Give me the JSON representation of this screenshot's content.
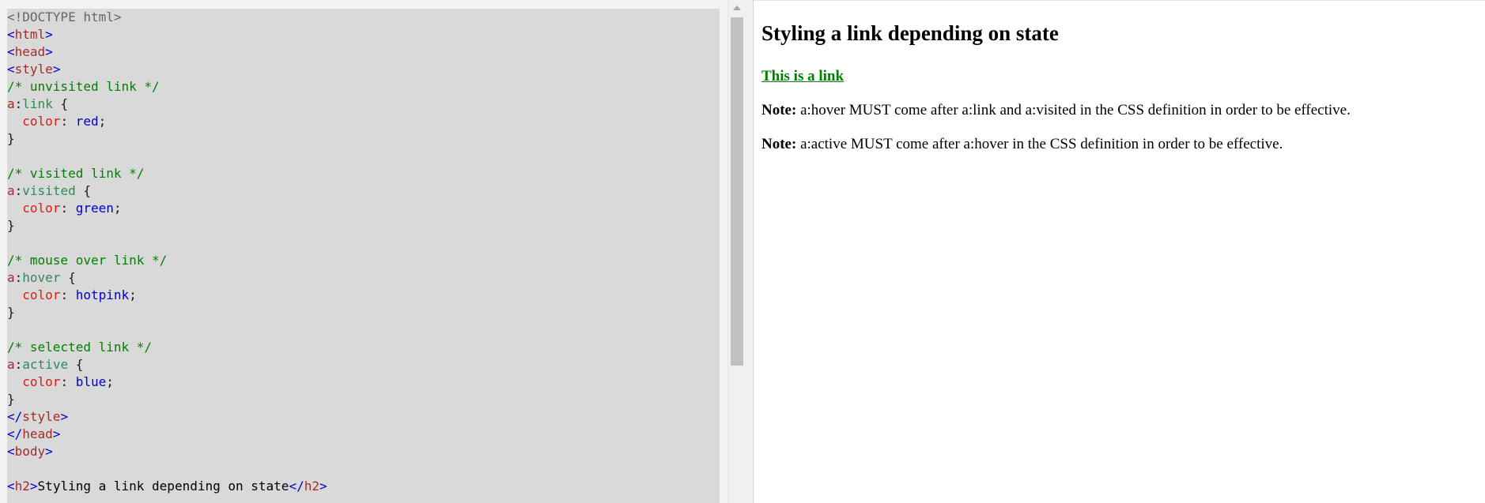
{
  "editor": {
    "lines": [
      [
        {
          "t": "<!DOCTYPE html>",
          "c": "doc"
        }
      ],
      [
        {
          "t": "<",
          "c": "br"
        },
        {
          "t": "html",
          "c": "tag"
        },
        {
          "t": ">",
          "c": "br"
        }
      ],
      [
        {
          "t": "<",
          "c": "br"
        },
        {
          "t": "head",
          "c": "tag"
        },
        {
          "t": ">",
          "c": "br"
        }
      ],
      [
        {
          "t": "<",
          "c": "br"
        },
        {
          "t": "style",
          "c": "tag"
        },
        {
          "t": ">",
          "c": "br"
        }
      ],
      [
        {
          "t": "/* unvisited link */",
          "c": "com"
        }
      ],
      [
        {
          "t": "a",
          "c": "sel"
        },
        {
          "t": ":",
          "c": "pc"
        },
        {
          "t": "link",
          "c": "pcls"
        },
        {
          "t": " {",
          "c": "pc"
        }
      ],
      [
        {
          "t": "  ",
          "c": "plain"
        },
        {
          "t": "color",
          "c": "prop"
        },
        {
          "t": ": ",
          "c": "pc"
        },
        {
          "t": "red",
          "c": "val"
        },
        {
          "t": ";",
          "c": "pc"
        }
      ],
      [
        {
          "t": "}",
          "c": "pc"
        }
      ],
      [
        {
          "t": "",
          "c": "plain"
        }
      ],
      [
        {
          "t": "/* visited link */",
          "c": "com"
        }
      ],
      [
        {
          "t": "a",
          "c": "sel"
        },
        {
          "t": ":",
          "c": "pc"
        },
        {
          "t": "visited",
          "c": "pcls"
        },
        {
          "t": " {",
          "c": "pc"
        }
      ],
      [
        {
          "t": "  ",
          "c": "plain"
        },
        {
          "t": "color",
          "c": "prop"
        },
        {
          "t": ": ",
          "c": "pc"
        },
        {
          "t": "green",
          "c": "val"
        },
        {
          "t": ";",
          "c": "pc"
        }
      ],
      [
        {
          "t": "}",
          "c": "pc"
        }
      ],
      [
        {
          "t": "",
          "c": "plain"
        }
      ],
      [
        {
          "t": "/* mouse over link */",
          "c": "com"
        }
      ],
      [
        {
          "t": "a",
          "c": "sel"
        },
        {
          "t": ":",
          "c": "pc"
        },
        {
          "t": "hover",
          "c": "pcls"
        },
        {
          "t": " {",
          "c": "pc"
        }
      ],
      [
        {
          "t": "  ",
          "c": "plain"
        },
        {
          "t": "color",
          "c": "prop"
        },
        {
          "t": ": ",
          "c": "pc"
        },
        {
          "t": "hotpink",
          "c": "val"
        },
        {
          "t": ";",
          "c": "pc"
        }
      ],
      [
        {
          "t": "}",
          "c": "pc"
        }
      ],
      [
        {
          "t": "",
          "c": "plain"
        }
      ],
      [
        {
          "t": "/* selected link */",
          "c": "com"
        }
      ],
      [
        {
          "t": "a",
          "c": "sel"
        },
        {
          "t": ":",
          "c": "pc"
        },
        {
          "t": "active",
          "c": "pcls"
        },
        {
          "t": " {",
          "c": "pc"
        }
      ],
      [
        {
          "t": "  ",
          "c": "plain"
        },
        {
          "t": "color",
          "c": "prop"
        },
        {
          "t": ": ",
          "c": "pc"
        },
        {
          "t": "blue",
          "c": "val"
        },
        {
          "t": ";",
          "c": "pc"
        }
      ],
      [
        {
          "t": "}",
          "c": "pc"
        }
      ],
      [
        {
          "t": "</",
          "c": "br"
        },
        {
          "t": "style",
          "c": "tag"
        },
        {
          "t": ">",
          "c": "br"
        }
      ],
      [
        {
          "t": "</",
          "c": "br"
        },
        {
          "t": "head",
          "c": "tag"
        },
        {
          "t": ">",
          "c": "br"
        }
      ],
      [
        {
          "t": "<",
          "c": "br"
        },
        {
          "t": "body",
          "c": "tag"
        },
        {
          "t": ">",
          "c": "br"
        }
      ],
      [
        {
          "t": "",
          "c": "plain"
        }
      ],
      [
        {
          "t": "<",
          "c": "br"
        },
        {
          "t": "h2",
          "c": "tag"
        },
        {
          "t": ">",
          "c": "br"
        },
        {
          "t": "Styling a link depending on state",
          "c": "plain"
        },
        {
          "t": "</",
          "c": "br"
        },
        {
          "t": "h2",
          "c": "tag"
        },
        {
          "t": ">",
          "c": "br"
        }
      ]
    ]
  },
  "preview": {
    "title": "Styling a link depending on state",
    "link_text": "This is a link",
    "note_label": "Note:",
    "note1_text": " a:hover MUST come after a:link and a:visited in the CSS definition in order to be effective.",
    "note2_text": " a:active MUST come after a:hover in the CSS definition in order to be effective."
  },
  "colors": {
    "editor_bg": "#d9d9d9",
    "link_visited": "#008000",
    "comment": "#008000",
    "tag": "#a52a2a",
    "bracket": "#0000cd",
    "property": "#e01818",
    "value": "#0000cd"
  }
}
